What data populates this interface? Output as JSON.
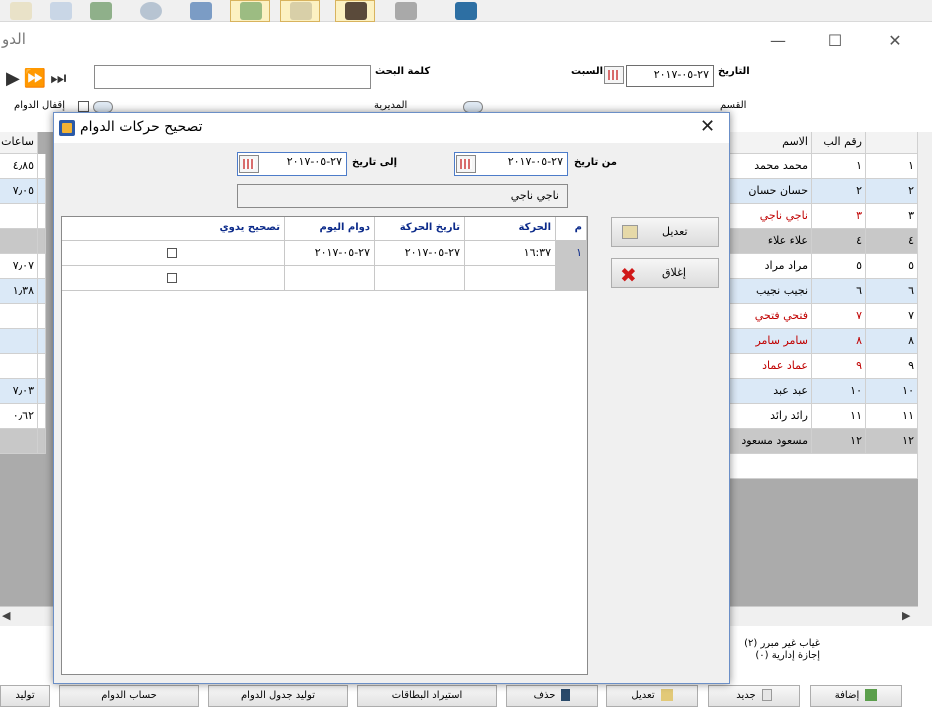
{
  "toolbar": {
    "active_indices": [
      6,
      7,
      8
    ]
  },
  "window": {
    "title_fragment": "الدو",
    "controls": {
      "minimize": "—",
      "maximize": "☐",
      "close": "✕"
    }
  },
  "filters": {
    "search_label": "كلمة البحث",
    "search_value": "",
    "day_name": "السبت",
    "date_label": "التاريخ",
    "date_value": "٢٧-٠٥-٢٠١٧",
    "section_label": "القسم",
    "directorate_label": "المديرية",
    "close_attendance_label": "إقفال الدوام"
  },
  "bg_grid": {
    "headers": {
      "row_num": "",
      "id": "رقم الب",
      "name": "الاسم",
      "hours": "ساعات"
    },
    "rows": [
      {
        "n": "١",
        "id": "١",
        "name": "محمد محمد",
        "hours": "٤٫٨٥",
        "red": false
      },
      {
        "n": "٢",
        "id": "٢",
        "name": "حسان حسان",
        "hours": "٧٫٠٥",
        "red": false
      },
      {
        "n": "٣",
        "id": "٣",
        "name": "ناجي ناجي",
        "hours": "",
        "red": true
      },
      {
        "n": "٤",
        "id": "٤",
        "name": "علاء علاء",
        "hours": "",
        "red": false
      },
      {
        "n": "٥",
        "id": "٥",
        "name": "مراد مراد",
        "hours": "٧٫٠٧",
        "red": false
      },
      {
        "n": "٦",
        "id": "٦",
        "name": "نجيب نجيب",
        "hours": "١٫٣٨",
        "red": false
      },
      {
        "n": "٧",
        "id": "٧",
        "name": "فتحي فتحي",
        "hours": "",
        "red": true
      },
      {
        "n": "٨",
        "id": "٨",
        "name": "سامر سامر",
        "hours": "",
        "red": true
      },
      {
        "n": "٩",
        "id": "٩",
        "name": "عماد عماد",
        "hours": "",
        "red": true
      },
      {
        "n": "١٠",
        "id": "١٠",
        "name": "عبد عبد",
        "hours": "٧٫٠٣",
        "red": false
      },
      {
        "n": "١١",
        "id": "١١",
        "name": "رائد رائد",
        "hours": "٠٫٦٢",
        "red": false
      },
      {
        "n": "١٢",
        "id": "١٢",
        "name": "مسعود مسعود",
        "hours": "",
        "red": false
      }
    ]
  },
  "legend": {
    "line1": "غياب غير مبرر (٢)",
    "line2": "إجازة إدارية (٠)"
  },
  "dialog": {
    "title": "تصحيح حركات الدوام",
    "from_date_label": "من تاريخ",
    "from_date_value": "٢٧-٠٥-٢٠١٧",
    "to_date_label": "إلى تاريخ",
    "to_date_value": "٢٧-٠٥-٢٠١٧",
    "employee_name": "ناجي ناجي",
    "edit_button": "تعديل",
    "close_button": "إغلاق",
    "grid": {
      "headers": {
        "idx": "م",
        "movement": "الحركة",
        "movement_date": "تاريخ الحركة",
        "day_shift": "دوام اليوم",
        "manual_fix": "تصحيح يدوي"
      },
      "rows": [
        {
          "idx": "١",
          "movement": "١٦:٣٧",
          "movement_date": "٢٧-٠٥-٢٠١٧",
          "day_shift": "٢٧-٠٥-٢٠١٧",
          "manual_fix": false
        },
        {
          "idx": "",
          "movement": "",
          "movement_date": "",
          "day_shift": "",
          "manual_fix": false
        }
      ]
    }
  },
  "bottom_buttons": {
    "add": "إضافة",
    "new": "جديد",
    "edit": "تعديل",
    "delete": "حذف",
    "import_cards": "استيراد البطاقات",
    "gen_schedule": "توليد جدول الدوام",
    "calc_attendance": "حساب الدوام",
    "generate": "توليد"
  },
  "colors": {
    "dialog_border": "#6b8fc7",
    "header_text": "#0b2a8a",
    "absent_red": "#c00000",
    "row_alt": "#dbe9f7"
  }
}
